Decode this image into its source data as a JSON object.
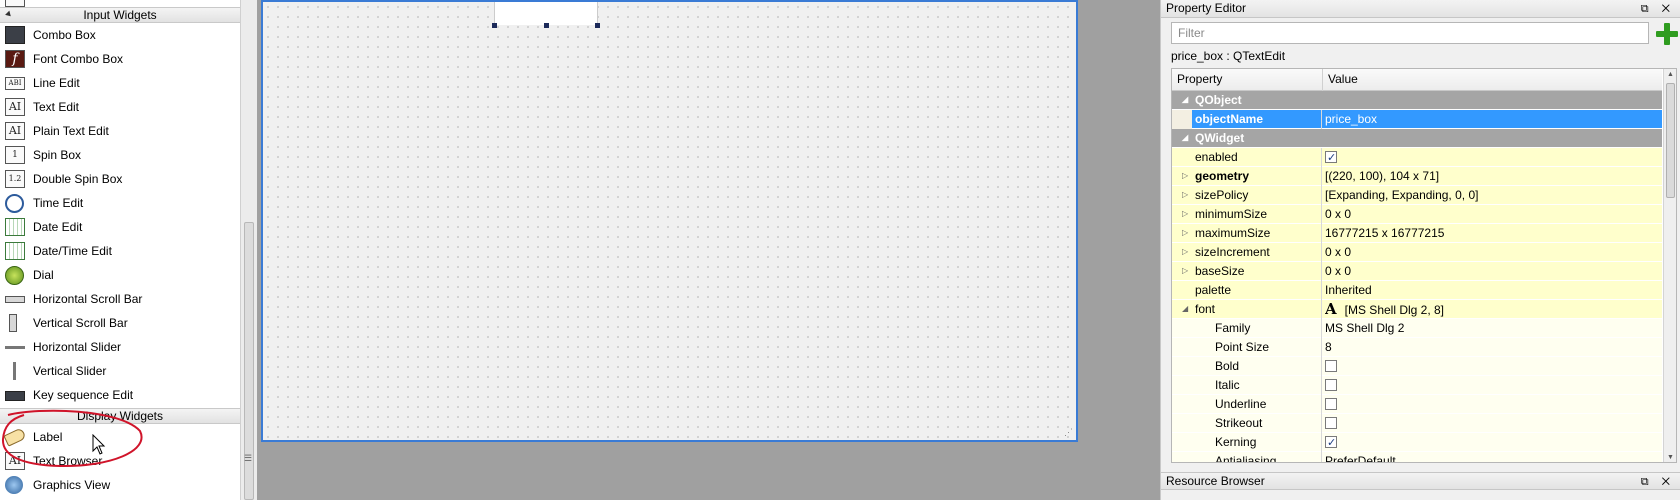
{
  "widget_box": {
    "categories": {
      "input": "Input Widgets",
      "display": "Display Widgets"
    },
    "input_items": [
      {
        "label": "Combo Box",
        "icon": "combo-box-icon"
      },
      {
        "label": "Font Combo Box",
        "icon": "font-combo-box-icon"
      },
      {
        "label": "Line Edit",
        "icon": "line-edit-icon"
      },
      {
        "label": "Text Edit",
        "icon": "text-edit-icon"
      },
      {
        "label": "Plain Text Edit",
        "icon": "plain-text-edit-icon"
      },
      {
        "label": "Spin Box",
        "icon": "spin-box-icon"
      },
      {
        "label": "Double Spin Box",
        "icon": "double-spin-box-icon"
      },
      {
        "label": "Time Edit",
        "icon": "clock-icon"
      },
      {
        "label": "Date Edit",
        "icon": "calendar-icon"
      },
      {
        "label": "Date/Time Edit",
        "icon": "calendar-clock-icon"
      },
      {
        "label": "Dial",
        "icon": "dial-icon"
      },
      {
        "label": "Horizontal Scroll Bar",
        "icon": "horizontal-scrollbar-icon"
      },
      {
        "label": "Vertical Scroll Bar",
        "icon": "vertical-scrollbar-icon"
      },
      {
        "label": "Horizontal Slider",
        "icon": "horizontal-slider-icon"
      },
      {
        "label": "Vertical Slider",
        "icon": "vertical-slider-icon"
      },
      {
        "label": "Key sequence Edit",
        "icon": "key-sequence-icon"
      }
    ],
    "display_items": [
      {
        "label": "Label",
        "icon": "label-tag-icon"
      },
      {
        "label": "Text Browser",
        "icon": "text-browser-icon"
      },
      {
        "label": "Graphics View",
        "icon": "graphics-view-icon"
      }
    ],
    "icon_glyphs": {
      "font_combo": "f",
      "line_edit": "ABI",
      "text_edit": "AI",
      "plain_text_edit": "AI",
      "spin_box": "1",
      "double_spin_box": "1.2"
    }
  },
  "canvas": {
    "selected_widget": "price_box"
  },
  "property_editor": {
    "title": "Property Editor",
    "dock_buttons": "⧉ ✕",
    "filter_placeholder": "Filter",
    "object_caption": "price_box : QTextEdit",
    "columns": {
      "property": "Property",
      "value": "Value"
    },
    "rows": {
      "qobject": {
        "name": "QObject"
      },
      "objectName": {
        "name": "objectName",
        "value": "price_box"
      },
      "qwidget": {
        "name": "QWidget"
      },
      "enabled": {
        "name": "enabled",
        "checked": true
      },
      "geometry": {
        "name": "geometry",
        "value": "[(220, 100), 104 x 71]"
      },
      "sizePolicy": {
        "name": "sizePolicy",
        "value": "[Expanding, Expanding, 0, 0]"
      },
      "minimumSize": {
        "name": "minimumSize",
        "value": "0 x 0"
      },
      "maximumSize": {
        "name": "maximumSize",
        "value": "16777215 x 16777215"
      },
      "sizeIncrement": {
        "name": "sizeIncrement",
        "value": "0 x 0"
      },
      "baseSize": {
        "name": "baseSize",
        "value": "0 x 0"
      },
      "palette": {
        "name": "palette",
        "value": "Inherited"
      },
      "font": {
        "name": "font",
        "glyph": "A",
        "value": "[MS Shell Dlg 2, 8]"
      },
      "family": {
        "name": "Family",
        "value": "MS Shell Dlg 2"
      },
      "pointSize": {
        "name": "Point Size",
        "value": "8"
      },
      "bold": {
        "name": "Bold",
        "checked": false
      },
      "italic": {
        "name": "Italic",
        "checked": false
      },
      "underline": {
        "name": "Underline",
        "checked": false
      },
      "strikeout": {
        "name": "Strikeout",
        "checked": false
      },
      "kerning": {
        "name": "Kerning",
        "checked": true
      },
      "antialiasing": {
        "name": "Antialiasing",
        "value": "PreferDefault"
      }
    }
  },
  "resource_browser": {
    "title": "Resource Browser",
    "dock_buttons": "⧉ ✕"
  },
  "colors": {
    "selection": "#3399ff",
    "group_header": "#a5a5a5",
    "property_row": "#ffffcc",
    "form_border": "#3a7bd5",
    "annotation_circle": "#d0142a"
  }
}
